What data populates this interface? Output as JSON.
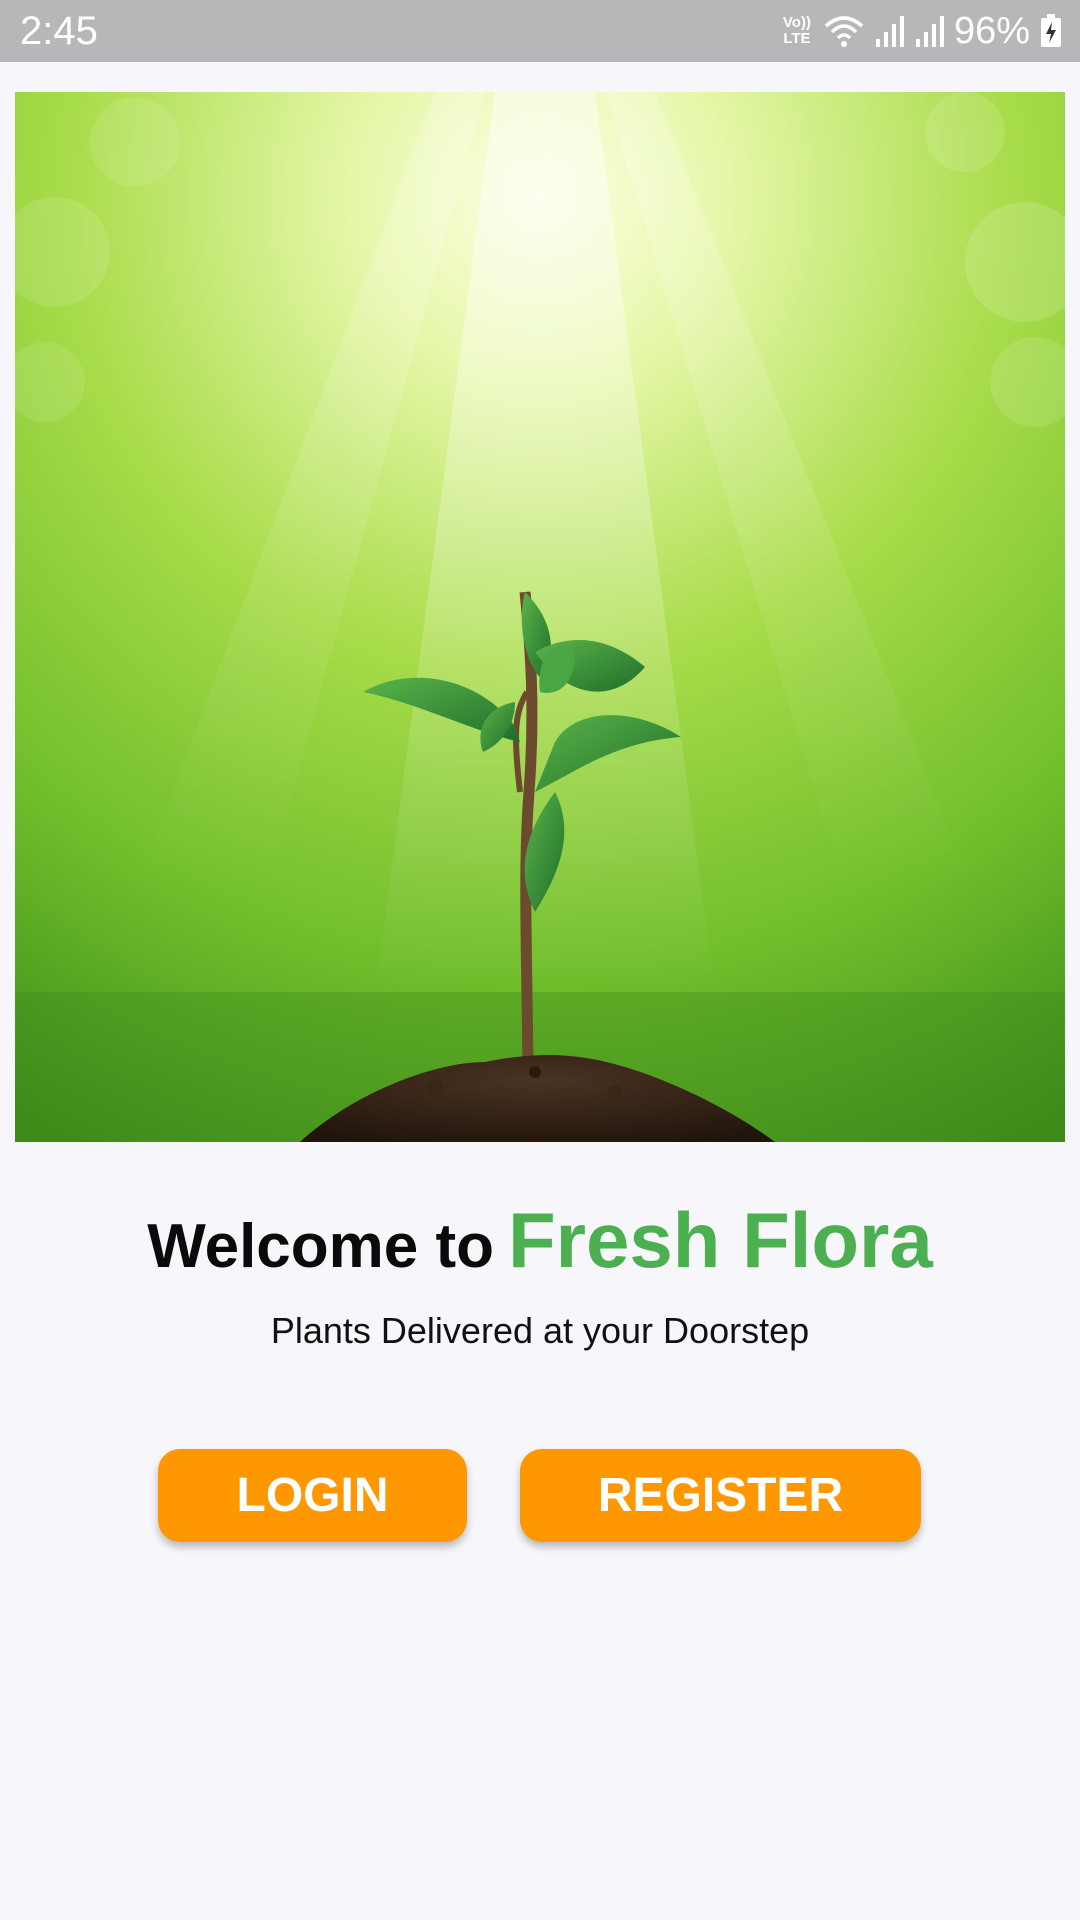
{
  "status_bar": {
    "time": "2:45",
    "network_label": "Vo)) LTE",
    "battery_percent": "96%",
    "icons": [
      "volte-icon",
      "wifi-icon",
      "signal-icon",
      "signal-icon",
      "battery-charging-icon"
    ]
  },
  "hero": {
    "image": "seedling-sunlight-image"
  },
  "welcome": {
    "prefix": "Welcome to",
    "brand": "Fresh Flora",
    "tagline": "Plants Delivered at your Doorstep"
  },
  "actions": {
    "login_label": "LOGIN",
    "register_label": "REGISTER"
  },
  "colors": {
    "accent_green": "#4caf50",
    "button_orange": "#ff9800",
    "status_bar": "#b7b7b9",
    "background": "#f7f7fb"
  }
}
